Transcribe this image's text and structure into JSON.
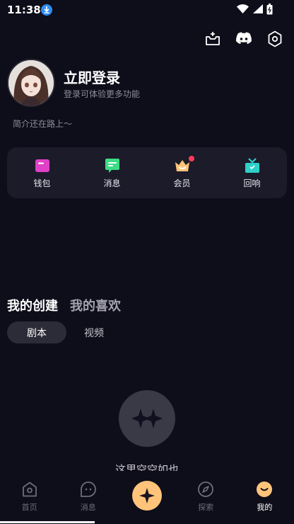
{
  "status": {
    "time": "11:38"
  },
  "profile": {
    "login_title": "立即登录",
    "login_subtitle": "登录可体验更多功能",
    "bio": "简介还在路上～"
  },
  "quick_actions": [
    {
      "label": "钱包",
      "icon": "wallet-icon",
      "color": "#e040c8"
    },
    {
      "label": "消息",
      "icon": "message-icon",
      "color": "#3ddc84"
    },
    {
      "label": "会员",
      "icon": "crown-icon",
      "color": "#ffc47a"
    },
    {
      "label": "回响",
      "icon": "gift-icon",
      "color": "#2ed1c9"
    }
  ],
  "content_tabs": {
    "active": "我的创建",
    "inactive": "我的喜欢"
  },
  "sub_tabs": {
    "active": "剧本",
    "inactive": "视频"
  },
  "empty_state": {
    "text": "这里空空如也"
  },
  "bottom_nav": [
    {
      "label": "首页",
      "icon": "home-icon"
    },
    {
      "label": "消息",
      "icon": "chat-bubble-icon"
    },
    {
      "label": "",
      "icon": "sparkle-icon"
    },
    {
      "label": "探索",
      "icon": "compass-icon"
    },
    {
      "label": "我的",
      "icon": "profile-smile-icon"
    }
  ],
  "colors": {
    "background": "#0e0d1a",
    "card": "#1c1b2a",
    "accent": "#ffc47a"
  }
}
